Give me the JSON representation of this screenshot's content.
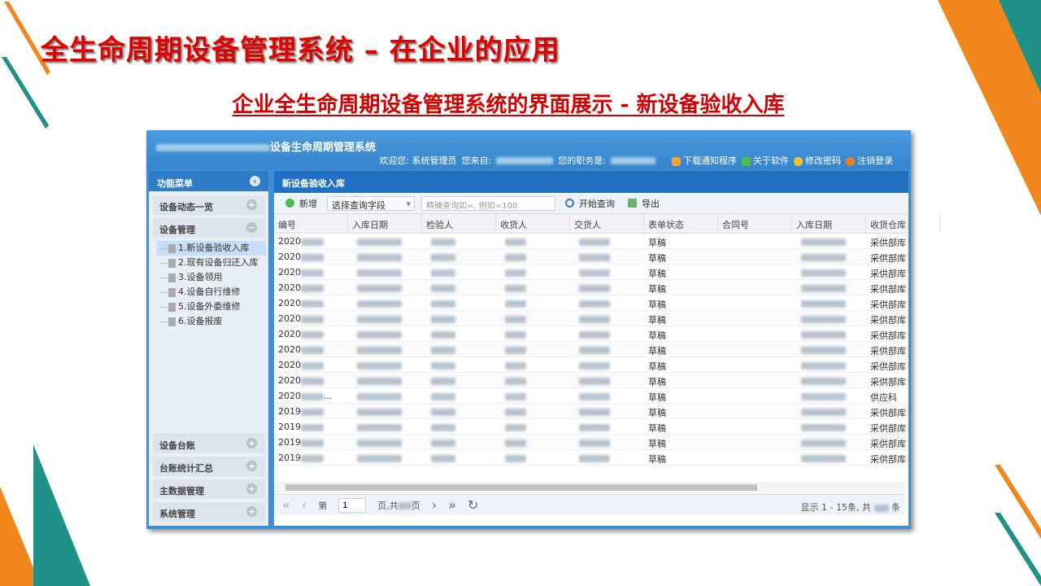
{
  "slide": {
    "title": "全生命周期设备管理系统 – 在企业的应用",
    "subtitle": "企业全生命周期设备管理系统的界面展示 - 新设备验收入库"
  },
  "colors": {
    "orange": "#f0861c",
    "teal": "#1f9186",
    "title_red": "#e00000",
    "header_blue": "#3d8fd6"
  },
  "app": {
    "title": "设备生命周期管理系统",
    "welcome": "欢迎您: 系统管理员",
    "from_label": "您来自:",
    "role_label": "您的职务是:",
    "links": [
      {
        "label": "下载通知程序",
        "icon": "bell-icon"
      },
      {
        "label": "关于软件",
        "icon": "info-icon"
      },
      {
        "label": "修改密码",
        "icon": "key-icon"
      },
      {
        "label": "注销登录",
        "icon": "power-icon"
      }
    ]
  },
  "sidebar": {
    "title": "功能菜单",
    "sections": [
      "设备动态一览",
      "设备管理",
      "设备台账",
      "台账统计汇总",
      "主数据管理",
      "系统管理"
    ],
    "tree": [
      "1.新设备验收入库",
      "2.现有设备归还入库",
      "3.设备领用",
      "4.设备自行维修",
      "5.设备外委维修",
      "6.设备报废"
    ]
  },
  "main": {
    "panel_title": "新设备验收入库",
    "toolbar": {
      "add": "新增",
      "field_select": "选择查询字段",
      "search_placeholder": "精确查询如=, 例如=100",
      "search": "开始查询",
      "export": "导出"
    },
    "columns": [
      "编号",
      "入库日期",
      "检验人",
      "收货人",
      "交货人",
      "表单状态",
      "合同号",
      "入库日期",
      "收货仓库"
    ],
    "rows": [
      {
        "id": "2020",
        "status": "草稿",
        "warehouse": "采供部库"
      },
      {
        "id": "2020",
        "status": "草稿",
        "warehouse": "采供部库"
      },
      {
        "id": "2020",
        "status": "草稿",
        "warehouse": "采供部库"
      },
      {
        "id": "2020",
        "status": "草稿",
        "warehouse": "采供部库"
      },
      {
        "id": "2020",
        "status": "草稿",
        "warehouse": "采供部库"
      },
      {
        "id": "2020",
        "status": "草稿",
        "warehouse": "采供部库"
      },
      {
        "id": "2020",
        "status": "草稿",
        "warehouse": "采供部库"
      },
      {
        "id": "2020",
        "status": "草稿",
        "warehouse": "采供部库"
      },
      {
        "id": "2020",
        "status": "草稿",
        "warehouse": "采供部库"
      },
      {
        "id": "2020",
        "status": "草稿",
        "warehouse": "采供部库"
      },
      {
        "id": "2020",
        "id_suffix": "...",
        "status": "草稿",
        "warehouse": "供应科"
      },
      {
        "id": "2019",
        "status": "草稿",
        "warehouse": "采供部库"
      },
      {
        "id": "2019",
        "status": "草稿",
        "warehouse": "采供部库"
      },
      {
        "id": "2019",
        "status": "草稿",
        "warehouse": "采供部库"
      },
      {
        "id": "2019",
        "status": "草稿",
        "warehouse": "采供部库"
      }
    ],
    "pager": {
      "page_label": "第",
      "page": "1",
      "of_label": "页,共",
      "page_suffix": "页",
      "info": "显示 1 - 15条, 共",
      "info_suffix": "条"
    }
  }
}
